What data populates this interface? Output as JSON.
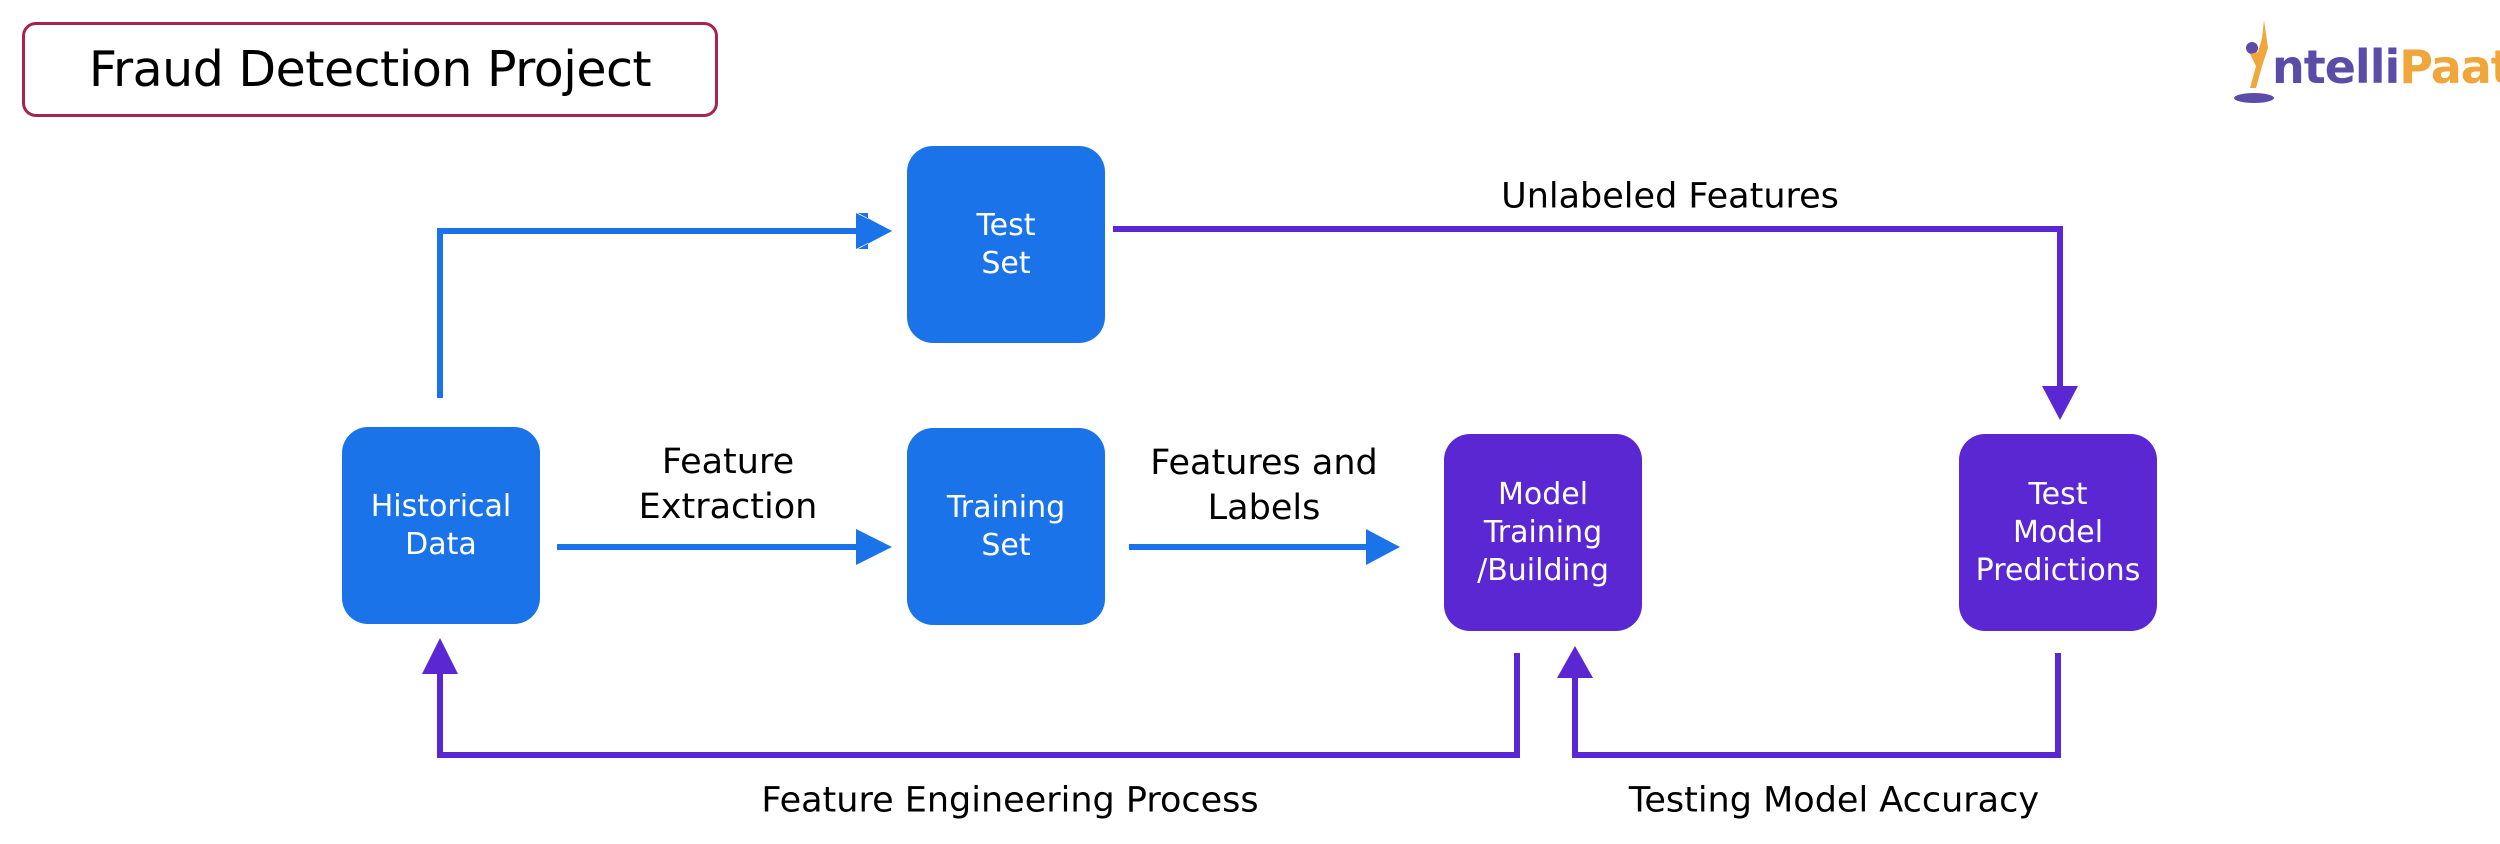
{
  "title": "Fraud Detection Project",
  "logo": {
    "part1": "ntelli",
    "part2": "Paat",
    "icon": "person-jumping-logo-icon"
  },
  "colors": {
    "blue": "#1a73e8",
    "purple": "#5b27d2",
    "title_border": "#a8234f",
    "logo_blue": "#5b4ca8",
    "logo_orange": "#f0a63a"
  },
  "nodes": {
    "historical_data": "Historical\nData",
    "test_set": "Test\nSet",
    "training_set": "Training\nSet",
    "model_training": "Model\nTraining\n/Building",
    "test_model_predictions": "Test\nModel\nPredictions"
  },
  "edges": {
    "feature_extraction": "Feature\nExtraction",
    "features_and_labels": "Features and\nLabels",
    "unlabeled_features": "Unlabeled Features",
    "feature_engineering_process": "Feature Engineering Process",
    "testing_model_accuracy": "Testing Model Accuracy"
  }
}
